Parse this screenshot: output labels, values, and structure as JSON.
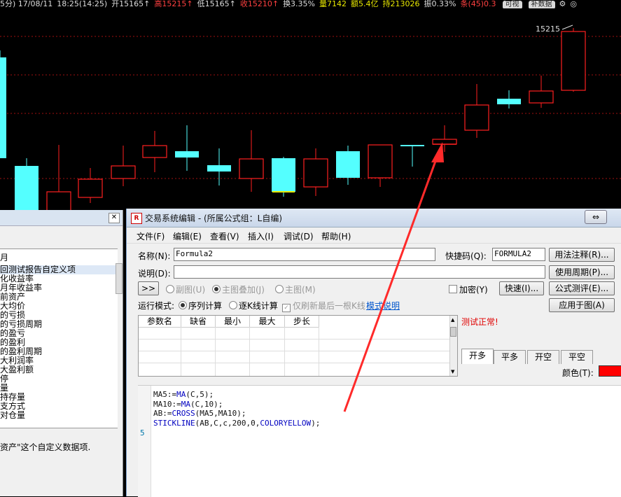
{
  "status_bar": {
    "prefix": "5分) 17/08/11",
    "time": "18:25(14:25)",
    "open": "开15165↑",
    "high": "高15215↑",
    "low": "低15165↑",
    "close": "收15210↑",
    "turnover_rate": "换3.35%",
    "volume": "量7142",
    "amount": "额5.4亿",
    "hold": "持213026",
    "amplitude": "振0.33%",
    "extra": "条(45)0.3",
    "btn1": "可视",
    "btn2": "补数据"
  },
  "chart": {
    "price_label": "15215",
    "colors": {
      "up": "#ff2020",
      "down": "#54ffff",
      "grid": "#a01010",
      "stick": "#e8e800"
    }
  },
  "left_panel": {
    "header_partial": "月",
    "items": [
      "回测试报告自定义项",
      "化收益率",
      "月年收益率",
      "前资产",
      "大均价",
      "的亏损",
      "的亏损周期",
      "的盈亏",
      "的盈利",
      "的盈利周期",
      "大利润率",
      "大盈利额",
      "停",
      "量",
      "持存量",
      "支方式",
      "对仓量"
    ],
    "selected_index": 0,
    "description": "资产\"这个自定义数据项."
  },
  "editor": {
    "title": "交易系统编辑 - (所属公式组：L自编)",
    "title_icon": "R",
    "restore_button": "⇔",
    "menu": [
      "文件(F)",
      "编辑(E)",
      "查看(V)",
      "插入(I)",
      "调试(D)",
      "帮助(H)"
    ],
    "name_label": "名称(N):",
    "name_value": "Formula2",
    "shortcut_label": "快捷码(Q):",
    "shortcut_value": "FORMULA2",
    "desc_label": "说明(D):",
    "desc_value": "",
    "expand_button": ">>",
    "radio_sub": "副图(U)",
    "radio_main_overlay": "主图叠加(J)",
    "radio_main": "主图(M)",
    "encrypt_label": "加密(Y)",
    "fast_button": "快速(I)...",
    "run_mode_label": "运行模式:",
    "run_series": "序列计算",
    "run_kline": "逐K线计算",
    "refresh_last": "仅刷新最后一根K线",
    "mode_help": "模式说明",
    "buttons": [
      "用法注释(R)...",
      "使用周期(P)...",
      "公式测评(E)...",
      "应用于图(A)"
    ],
    "param_headers": [
      "参数名",
      "缺省",
      "最小",
      "最大",
      "步长"
    ],
    "test_status": "测试正常!",
    "tabs": [
      "开多",
      "平多",
      "开空",
      "平空"
    ],
    "color_label": "颜色(T):",
    "color_value": "#ff0000",
    "gutter_marker": "5",
    "code": [
      "MA5:=MA(C,5);",
      "MA10:=MA(C,10);",
      "AB:=CROSS(MA5,MA10);",
      "STICKLINE(AB,C,c,200,0,COLORYELLOW);"
    ]
  }
}
